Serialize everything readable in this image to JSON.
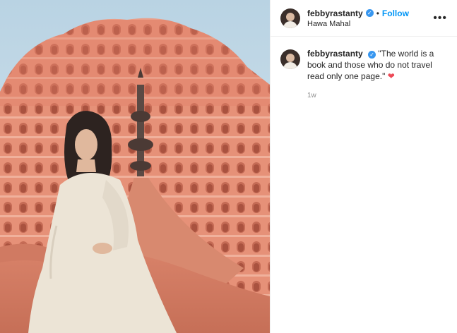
{
  "header": {
    "username": "febbyrastanty",
    "verified_icon": "verified-badge-icon",
    "separator": "•",
    "follow_label": "Follow",
    "location": "Hawa Mahal",
    "more_icon": "ellipsis-icon",
    "more_glyph": "•••"
  },
  "caption": {
    "username": "febbyrastanty",
    "text": "\"The world is a book and those who do not travel read only one page.\"",
    "heart_glyph": "❤",
    "time": "1w"
  },
  "colors": {
    "link": "#0095f6",
    "heart": "#ed4956",
    "facade": "#e48a74"
  }
}
